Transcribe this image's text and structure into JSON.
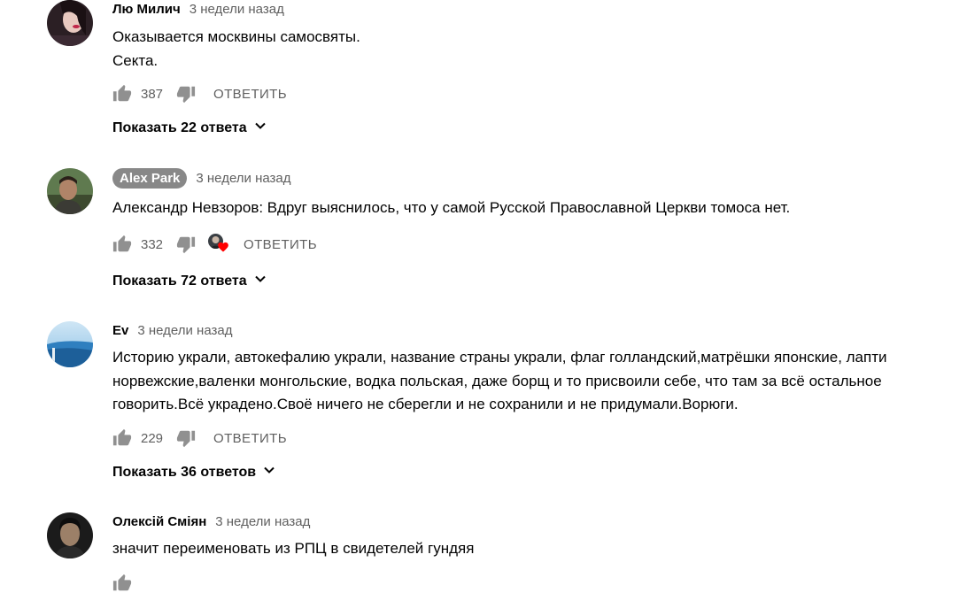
{
  "colors": {
    "text": "#030303",
    "secondary": "#606060",
    "badge_bg": "#888888",
    "heart": "#ff0000"
  },
  "comments": [
    {
      "author": "Лю Милич",
      "time": "3 недели назад",
      "text": "Оказывается москвины самосвяты.\nСекта.",
      "likes": "387",
      "reply_label": "ОТВЕТИТЬ",
      "show_replies": "Показать 22 ответа"
    },
    {
      "author": "Alex Park",
      "time": "3 недели назад",
      "text": "Александр Невзоров: Вдруг выяснилось, что у самой Русской Православной Церкви томоса нет.",
      "likes": "332",
      "reply_label": "ОТВЕТИТЬ",
      "show_replies": "Показать 72 ответа"
    },
    {
      "author": "Ev",
      "time": "3 недели назад",
      "text": "Историю украли, автокефалию украли, название страны украли, флаг голландский,матрёшки японские, лапти\nнорвежские,валенки монгольские, водка польская, даже борщ и то присвоили себе, что там за всё остальное\nговорить.Всё украдено.Своё ничего не сберегли и не сохранили и не придумали.Ворюги.",
      "likes": "229",
      "reply_label": "ОТВЕТИТЬ",
      "show_replies": "Показать 36 ответов"
    },
    {
      "author": "Олексій Сміян",
      "time": "3 недели назад",
      "text": "значит переименовать из РПЦ в свидетелей гундяя"
    }
  ]
}
